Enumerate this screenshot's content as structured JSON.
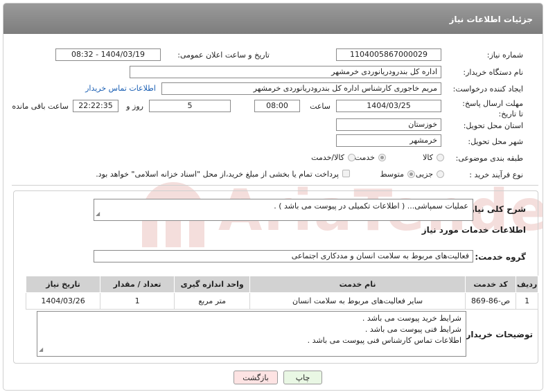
{
  "header": {
    "title": "جزئیات اطلاعات نیاز"
  },
  "form": {
    "need_number_label": "شماره نیاز:",
    "need_number": "1104005867000029",
    "announce_label": "تاریخ و ساعت اعلان عمومی:",
    "announce_value": "1404/03/19 - 08:32",
    "buyer_org_label": "نام دستگاه خریدار:",
    "buyer_org": "اداره کل بندرودریانوردی خرمشهر",
    "creator_label": "ایجاد کننده درخواست:",
    "creator": "مریم خاجوری کارشناس اداره کل بندرودریانوردی خرمشهر",
    "contact_link": "اطلاعات تماس خریدار",
    "deadline_label": "مهلت ارسال پاسخ: تا تاریخ:",
    "deadline_date": "1404/03/25",
    "time_label": "ساعت",
    "deadline_time": "08:00",
    "days_value": "5",
    "days_label": "روز و",
    "remaining_time": "22:22:35",
    "remaining_label": "ساعت باقی مانده",
    "province_label": "استان محل تحویل:",
    "province": "خوزستان",
    "city_label": "شهر محل تحویل:",
    "city": "خرمشهر",
    "category_label": "طبقه بندی موضوعی:",
    "category_options": [
      "کالا",
      "خدمت",
      "کالا/خدمت"
    ],
    "category_selected": 1,
    "process_label": "نوع فرآیند خرید :",
    "process_options": [
      "جزیی",
      "متوسط"
    ],
    "process_selected": 1,
    "payment_note": "پرداخت تمام یا بخشی از مبلغ خرید،از محل \"اسناد خزانه اسلامی\" خواهد بود."
  },
  "summary": {
    "label": "شرح کلی نیاز:",
    "text": "عملیات سمپاشی... ( اطلاعات تکمیلی در پیوست می باشد ) ."
  },
  "services": {
    "section_title": "اطلاعات خدمات مورد نیاز",
    "group_label": "گروه خدمت:",
    "group_value": "فعالیت‌های مربوط به سلامت انسان و مددکاری اجتماعی",
    "columns": [
      "ردیف",
      "کد خدمت",
      "نام خدمت",
      "واحد اندازه گیری",
      "تعداد / مقدار",
      "تاریخ نیاز"
    ],
    "rows": [
      [
        "1",
        "ص-86-869",
        "سایر فعالیت‌های مربوط به سلامت انسان",
        "متر مربع",
        "1",
        "1404/03/26"
      ]
    ]
  },
  "buyer_notes": {
    "label": "توضیحات خریدار:",
    "lines": [
      "شرایط خرید پیوست می باشد .",
      "شرایط فنی پیوست می باشد .",
      "اطلاعات تماس کارشناس فنی پیوست می باشد ."
    ]
  },
  "buttons": {
    "print": "چاپ",
    "back": "بازگشت"
  },
  "watermark": {
    "text": "AriaTender.net"
  },
  "colors": {
    "header_bg": "#8a8a8a",
    "link": "#1a5fb4",
    "back_button_bg": "#fde3e3",
    "print_button_bg": "#e9f7e4"
  }
}
